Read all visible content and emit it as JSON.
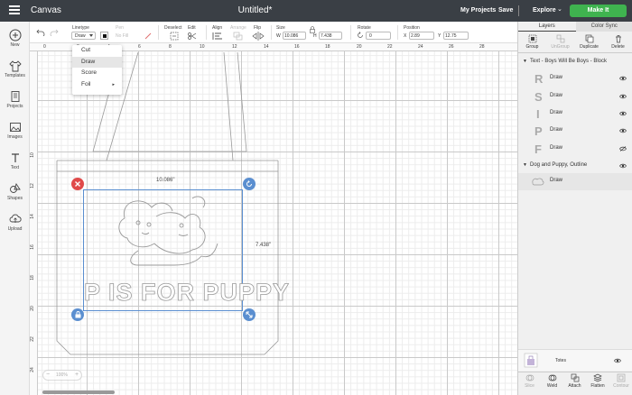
{
  "topbar": {
    "app_title": "Canvas",
    "doc_title": "Untitled*",
    "my_projects": "My Projects",
    "save": "Save",
    "explore": "Explore",
    "explore_chev": "⌄",
    "make_it": "Make It"
  },
  "leftbar": [
    {
      "label": "New",
      "icon": "plus-icon"
    },
    {
      "label": "Templates",
      "icon": "shirt-icon"
    },
    {
      "label": "Projects",
      "icon": "projects-icon"
    },
    {
      "label": "Images",
      "icon": "image-icon"
    },
    {
      "label": "Text",
      "icon": "text-icon"
    },
    {
      "label": "Shapes",
      "icon": "shapes-icon"
    },
    {
      "label": "Upload",
      "icon": "upload-icon"
    }
  ],
  "editbar": {
    "linetype_label": "Linetype",
    "linetype_value": "Draw",
    "pen_label": "Pen",
    "pen_value": "No Fill",
    "deselect": "Deselect",
    "edit": "Edit",
    "align": "Align",
    "arrange": "Arrange",
    "flip": "Flip",
    "size_label": "Size",
    "w_label": "W",
    "w_value": "10.086",
    "h_label": "H",
    "h_value": "7.438",
    "rotate_label": "Rotate",
    "rotate_value": "0",
    "position_label": "Position",
    "x_label": "X",
    "x_value": "2.89",
    "y_label": "Y",
    "y_value": "12.75"
  },
  "linetype_options": [
    {
      "label": "Cut",
      "selected": false,
      "submenu": false
    },
    {
      "label": "Draw",
      "selected": true,
      "submenu": false
    },
    {
      "label": "Score",
      "selected": false,
      "submenu": false
    },
    {
      "label": "Foil",
      "selected": false,
      "submenu": true
    }
  ],
  "submenu_arrow": "▸",
  "ruler_top": [
    "0",
    "2",
    "4",
    "6",
    "8",
    "10",
    "12",
    "14",
    "16",
    "18",
    "20",
    "22",
    "24",
    "26",
    "28"
  ],
  "ruler_left": [
    "10",
    "12",
    "14",
    "16",
    "18",
    "20",
    "22",
    "24"
  ],
  "canvas": {
    "width_label": "10.086\"",
    "height_label": "7.438\"",
    "text_art": "P IS FOR PUPPY",
    "zoom": "100%"
  },
  "panel": {
    "tabs": [
      "Layers",
      "Color Sync"
    ],
    "actions": [
      {
        "label": "Group",
        "disabled": false,
        "icon": "group-icon"
      },
      {
        "label": "UnGroup",
        "disabled": true,
        "icon": "ungroup-icon"
      },
      {
        "label": "Duplicate",
        "disabled": false,
        "icon": "duplicate-icon"
      },
      {
        "label": "Delete",
        "disabled": false,
        "icon": "trash-icon"
      }
    ],
    "groups": [
      {
        "title": "Text - Boys Will Be Boys - Block",
        "layers": [
          "Draw",
          "Draw",
          "Draw",
          "Draw",
          "Draw"
        ],
        "glyphs": [
          "R",
          "S",
          "I",
          "P",
          "F"
        ]
      },
      {
        "title": "Dog and Puppy, Outline",
        "layers": [
          "Draw"
        ],
        "glyphs": []
      }
    ],
    "totes": "Totes",
    "bottom_actions": [
      {
        "label": "Slice",
        "disabled": true
      },
      {
        "label": "Weld",
        "disabled": false
      },
      {
        "label": "Attach",
        "disabled": false
      },
      {
        "label": "Flatten",
        "disabled": false
      },
      {
        "label": "Contour",
        "disabled": true
      }
    ]
  },
  "colors": {
    "topbar": "#3a3f45",
    "make_it": "#3fb34f",
    "selection": "#5b8fd0",
    "delete_handle": "#e04a4a"
  }
}
